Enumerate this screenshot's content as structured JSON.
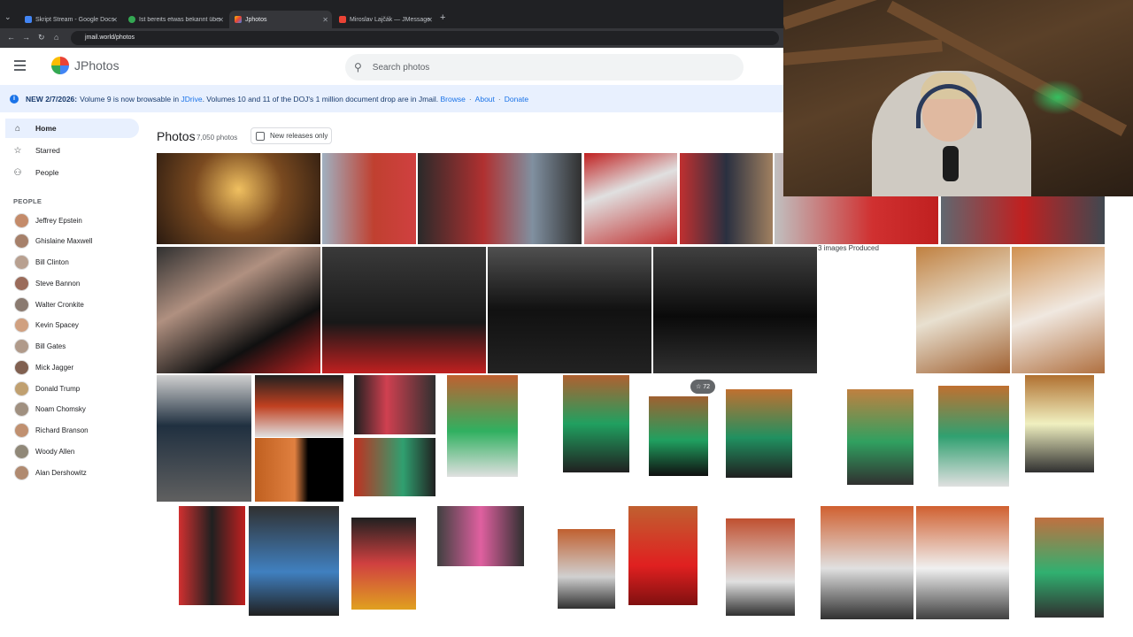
{
  "browser": {
    "tabs": [
      {
        "label": "Skript Stream - Google Docs",
        "color": "#4285f4",
        "active": false
      },
      {
        "label": "Ist bereits etwas bekannt über",
        "color": "#34a853",
        "active": false
      },
      {
        "label": "Jphotos",
        "color": "#fbbc04",
        "active": true
      },
      {
        "label": "Miroslav Lajčák — JMessage",
        "color": "#ea4335",
        "active": false
      }
    ],
    "url": "jmail.world/photos"
  },
  "header": {
    "brand": "JPhotos",
    "search_placeholder": "Search photos"
  },
  "banner": {
    "new_label": "NEW 2/7/2026:",
    "text_before": "Volume 9 is now browsable in",
    "jdrive": "JDrive",
    "text_after": ". Volumes 10 and 11 of the DOJ's 1 million document drop are in Jmail.",
    "browse": "Browse",
    "about": "About",
    "donate": "Donate"
  },
  "sidebar": {
    "nav": [
      {
        "label": "Home",
        "icon": "home-icon"
      },
      {
        "label": "Starred",
        "icon": "star-icon"
      },
      {
        "label": "People",
        "icon": "people-icon"
      }
    ],
    "people_header": "PEOPLE",
    "people": [
      "Jeffrey Epstein",
      "Ghislaine Maxwell",
      "Bill Clinton",
      "Steve Bannon",
      "Walter Cronkite",
      "Kevin Spacey",
      "Bill Gates",
      "Mick Jagger",
      "Donald Trump",
      "Noam Chomsky",
      "Richard Branson",
      "Woody Allen",
      "Alan Dershowitz"
    ]
  },
  "main": {
    "title": "Photos",
    "count": "7,050 photos",
    "filter_label": "New releases only",
    "badge": "72",
    "produced_label": "3 images Produced"
  }
}
